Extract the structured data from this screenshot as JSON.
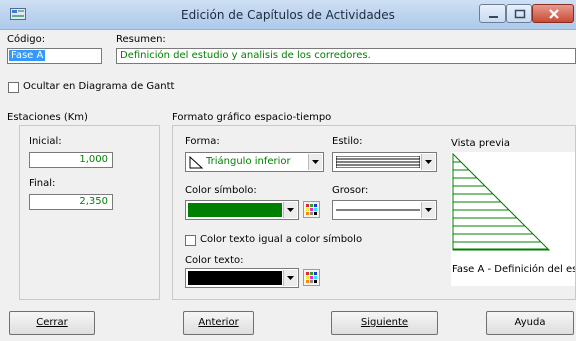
{
  "window": {
    "title": "Edición de Capítulos de Actividades"
  },
  "codigo": {
    "label": "Código:",
    "value": "Fase A"
  },
  "resumen": {
    "label": "Resumen:",
    "value": "Definición del estudio y analisis de los corredores."
  },
  "gantt": {
    "label": "Ocultar en Diagrama de Gantt",
    "checked": false
  },
  "estaciones": {
    "legend": "Estaciones (Km)",
    "inicial_label": "Inicial:",
    "inicial_value": "1,000",
    "final_label": "Final:",
    "final_value": "2,350"
  },
  "formato": {
    "legend": "Formato gráfico espacio-tiempo",
    "forma_label": "Forma:",
    "forma_value": "Triángulo inferior",
    "estilo_label": "Estilo:",
    "color_simbolo_label": "Color símbolo:",
    "color_simbolo": "#008000",
    "grosor_label": "Grosor:",
    "color_igual_label": "Color texto igual a color símbolo",
    "color_igual_checked": false,
    "color_texto_label": "Color texto:",
    "color_texto": "#000000"
  },
  "vista_previa": {
    "label": "Vista previa",
    "caption": "Fase A - Definición del estudi"
  },
  "buttons": {
    "cerrar": "Cerrar",
    "anterior": "Anterior",
    "siguiente": "Siguiente",
    "ayuda": "Ayuda"
  }
}
